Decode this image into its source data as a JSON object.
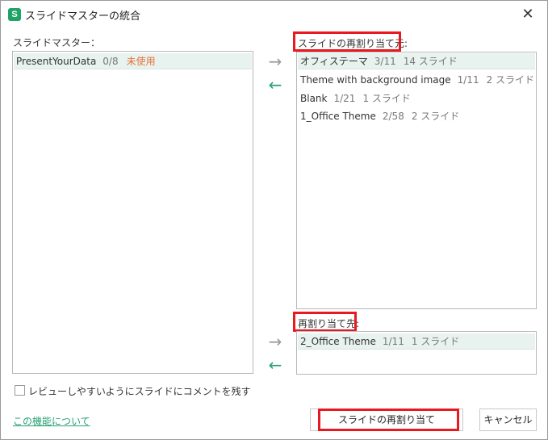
{
  "window": {
    "title": "スライドマスターの統合",
    "app_icon_letter": "S",
    "close_glyph": "✕"
  },
  "left": {
    "label": "スライドマスター：",
    "items": [
      {
        "name": "PresentYourData",
        "count": "0/8",
        "status": "未使用"
      }
    ]
  },
  "source": {
    "label": "スライドの再割り当て元:",
    "items": [
      {
        "name": "オフィステーマ",
        "index": "3/11",
        "slides": "14 スライド"
      },
      {
        "name": "Theme with background image",
        "index": "1/11",
        "slides": "2 スライド"
      },
      {
        "name": "Blank",
        "index": "1/21",
        "slides": "1 スライド"
      },
      {
        "name": "1_Office Theme",
        "index": "2/58",
        "slides": "2 スライド"
      }
    ]
  },
  "target": {
    "label": "再割り当て先:",
    "items": [
      {
        "name": "2_Office Theme",
        "index": "1/11",
        "slides": "1 スライド"
      }
    ]
  },
  "arrows": {
    "right": "→",
    "left": "←"
  },
  "checkbox": {
    "label": "レビューしやすいようにスライドにコメントを残す",
    "checked": false
  },
  "footer": {
    "link": "この機能について",
    "primary_button": "スライドの再割り当て",
    "cancel_button": "キャンセル"
  },
  "colors": {
    "accent": "#27a174",
    "highlight": "#e8191f",
    "unused": "#e8743b"
  }
}
